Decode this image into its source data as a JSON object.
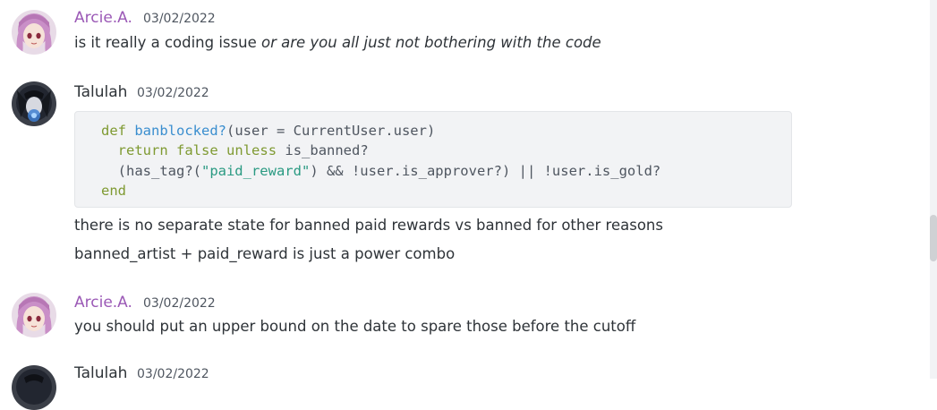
{
  "messages": [
    {
      "author": "Arcie.A.",
      "timestamp": "03/02/2022",
      "text_plain": "is it really a coding issue ",
      "text_italic": "or are you all just not bothering with the code"
    },
    {
      "author": "Talulah",
      "timestamp": "03/02/2022",
      "code": {
        "line1_kw": "def",
        "line1_fn": "banblocked?",
        "line1_rest": "(user = CurrentUser.user)",
        "line2_indent": "  ",
        "line2_kw1": "return",
        "line2_kw2": "false",
        "line2_kw3": "unless",
        "line2_rest": " is_banned?",
        "line3_a": "  (has_tag?(",
        "line3_str": "\"paid_reward\"",
        "line3_b": ") && !user.is_approver?) || !user.is_gold?",
        "line4_kw": "end"
      },
      "follow_up": [
        "there is no separate state for banned paid rewards vs banned for other reasons",
        "banned_artist + paid_reward is just a power combo"
      ]
    },
    {
      "author": "Arcie.A.",
      "timestamp": "03/02/2022",
      "text": "you should put an upper bound on the date to spare those before the cutoff"
    },
    {
      "author": "Talulah",
      "timestamp": "03/02/2022"
    }
  ],
  "colors": {
    "arcie_name": "#9b59b6",
    "talulah_name": "#2e3338"
  },
  "icons": {
    "arcie_avatar": "pink-haired-anime-avatar",
    "talulah_avatar": "dark-haired-anime-avatar"
  }
}
